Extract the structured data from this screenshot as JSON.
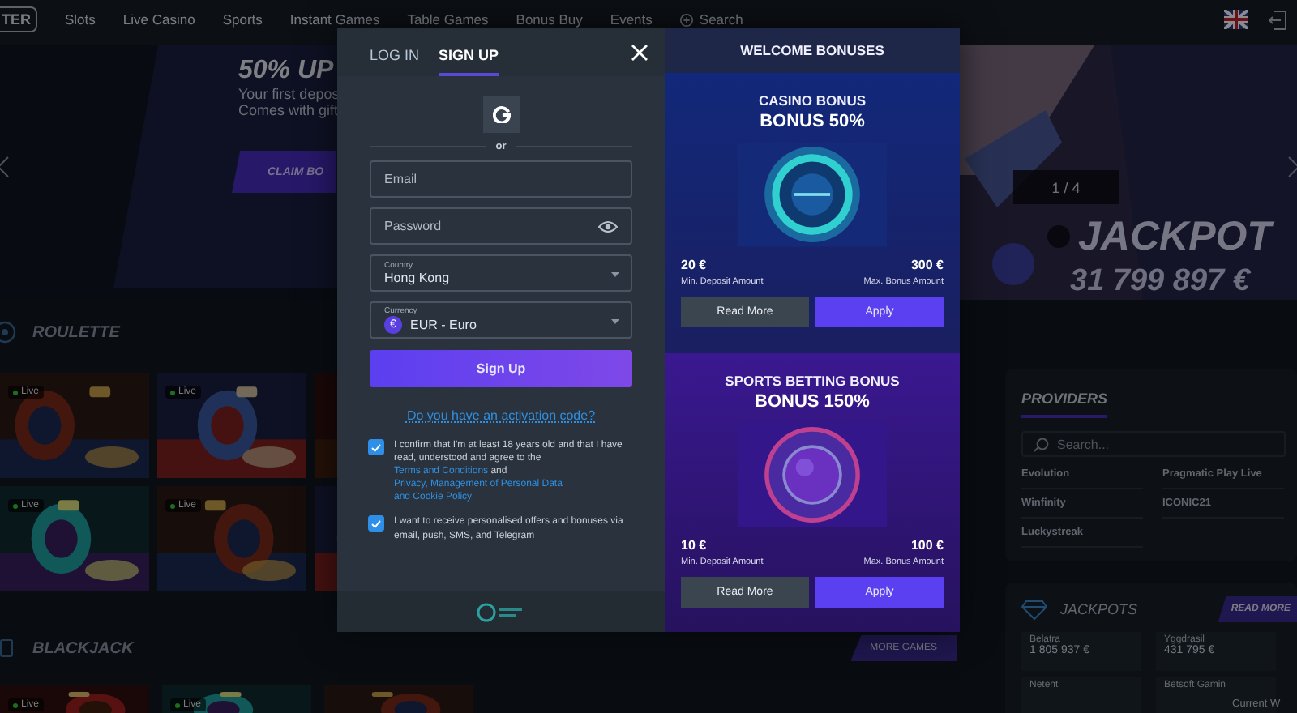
{
  "nav": {
    "logo": "TER",
    "items": [
      "Slots",
      "Live Casino",
      "Sports",
      "Instant Games",
      "Table Games",
      "Bonus Buy",
      "Events"
    ],
    "search": "Search"
  },
  "hero": {
    "title": "50% UP",
    "lines": [
      "Your first depos",
      "Comes with gift"
    ],
    "cta": "CLAIM BO",
    "counter": "1 / 4",
    "jackpot_title": "JACKPOT",
    "jackpot_amount": "31 799 897 €"
  },
  "sections": [
    {
      "title": "ROULETTE",
      "tiles": [
        {
          "kind": "picture",
          "badge": "Live"
        },
        {
          "kind": "picture",
          "badge": "Live"
        },
        {
          "kind": "picture"
        },
        {
          "kind": "picture",
          "badge": "Live"
        },
        {
          "kind": "picture",
          "badge": "Live"
        },
        {
          "kind": "picture"
        }
      ]
    },
    {
      "title": "BLACKJACK",
      "more": "MORE GAMES",
      "tiles": [
        {
          "kind": "picture",
          "badge": "Live"
        },
        {
          "kind": "picture",
          "badge": "Live"
        },
        {
          "kind": "picture"
        }
      ]
    }
  ],
  "providers": {
    "title": "PROVIDERS",
    "placeholder": "Search...",
    "items": [
      "Evolution",
      "Pragmatic Play Live",
      "Winfinity",
      "ICONIC21",
      "Luckystreak"
    ]
  },
  "jackpots": {
    "title": "JACKPOTS",
    "button": "READ MORE",
    "items": [
      {
        "provider": "Belatra",
        "amount": "1 805 937 €"
      },
      {
        "provider": "Yggdrasil",
        "amount": "431 795 €"
      },
      {
        "provider": "Netent"
      },
      {
        "provider": "Betsoft Gamin"
      }
    ],
    "note": "Current W"
  },
  "auth": {
    "tabs": [
      {
        "label": "LOG IN",
        "selected": false
      },
      {
        "label": "SIGN UP",
        "selected": true
      }
    ],
    "divider": "or",
    "email": {
      "placeholder": "Email"
    },
    "password": {
      "placeholder": "Password"
    },
    "country": {
      "label": "Country",
      "value": "Hong Kong"
    },
    "currency": {
      "label": "Currency",
      "value": "EUR - Euro",
      "symbol": "€"
    },
    "submit": "Sign Up",
    "activation_link": "Do you have an activation code?",
    "consents": [
      {
        "checked": true,
        "parts": [
          {
            "kind": "text",
            "text": "I confirm that I'm at least 18 years old and that I have read, understood and agree to the "
          },
          {
            "kind": "link",
            "text": "Terms and Conditions"
          },
          {
            "kind": "text",
            "text": " and "
          },
          {
            "kind": "link",
            "text": "Privacy, Management of Personal Data"
          },
          {
            "kind": "link",
            "text": "and Cookie Policy"
          }
        ]
      },
      {
        "checked": true,
        "parts": [
          {
            "kind": "text",
            "text": "I want to receive personalised offers and bonuses via email, push, SMS, and Telegram"
          }
        ]
      }
    ]
  },
  "bonuses": {
    "title": "WELCOME BONUSES",
    "cards": [
      {
        "kind": "casino",
        "title": "CASINO BONUS",
        "subtitle": "BONUS 50%",
        "min": "20 €",
        "min_label": "Min. Deposit Amount",
        "max": "300 €",
        "max_label": "Max. Bonus Amount",
        "buttons": [
          "Read More",
          "Apply"
        ]
      },
      {
        "kind": "sports",
        "title": "SPORTS BETTING BONUS",
        "subtitle": "BONUS 150%",
        "min": "10 €",
        "min_label": "Min. Deposit Amount",
        "max": "100 €",
        "max_label": "Max. Bonus Amount",
        "buttons": [
          "Read More",
          "Apply"
        ]
      }
    ]
  }
}
